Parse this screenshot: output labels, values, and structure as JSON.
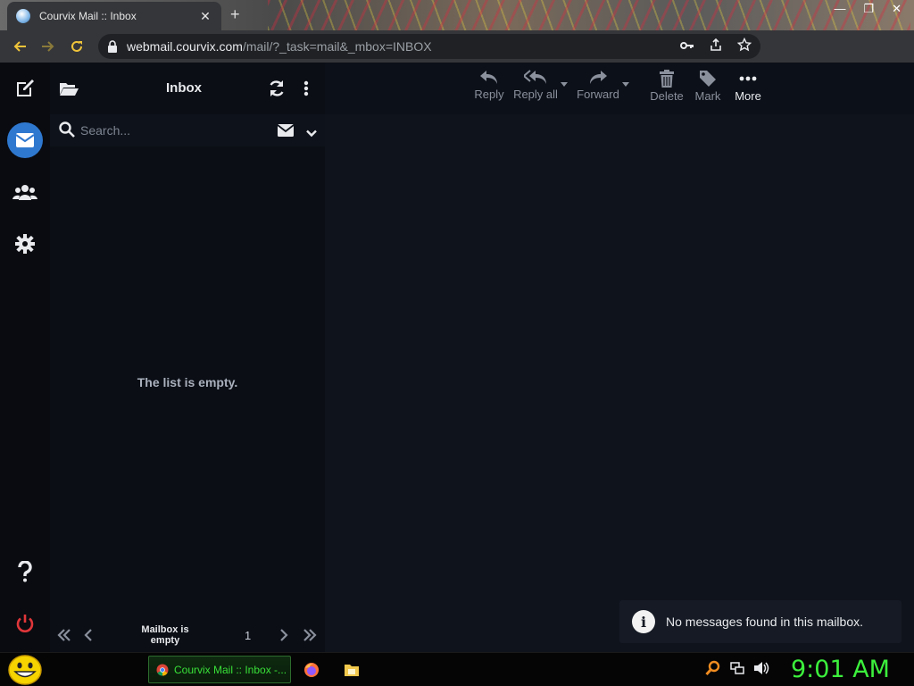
{
  "browser": {
    "tab_title": "Courvix Mail :: Inbox",
    "tab_close": "✕",
    "new_tab": "+",
    "window_controls": [
      "—",
      "❐",
      "✕"
    ],
    "url_host": "webmail.courvix.com",
    "url_path": "/mail/?_task=mail&_mbox=INBOX"
  },
  "list": {
    "title": "Inbox",
    "search_placeholder": "Search...",
    "empty_text": "The list is empty.",
    "pager_label": "Mailbox is empty",
    "page_number": "1"
  },
  "toolbar": {
    "reply": "Reply",
    "reply_all": "Reply all",
    "forward": "Forward",
    "delete": "Delete",
    "mark": "Mark",
    "more": "More"
  },
  "toast": {
    "icon": "i",
    "text": "No messages found in this mailbox."
  },
  "taskbar": {
    "chrome_task": "Courvix Mail :: Inbox -...",
    "clock": "9:01 AM"
  },
  "colors": {
    "accent": "#2f78cf",
    "logout": "#e0363a",
    "clock": "#3cf03c"
  }
}
